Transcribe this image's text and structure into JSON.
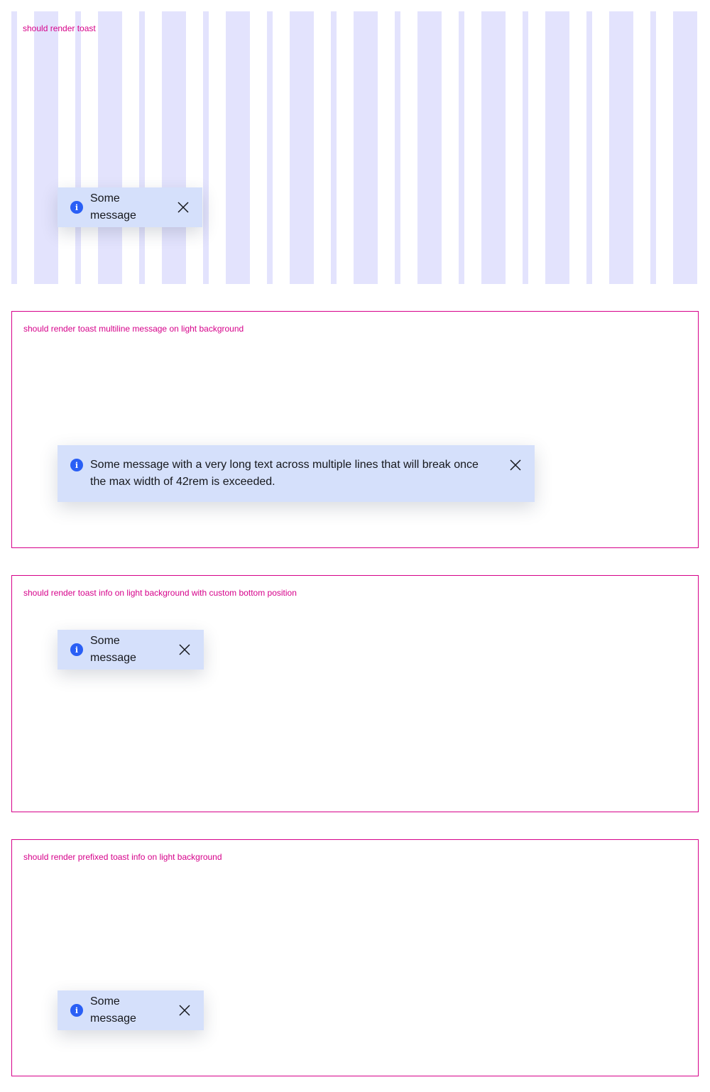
{
  "sections": [
    {
      "label": "should render toast",
      "toast": {
        "message": "Some message",
        "icon": "info-icon",
        "close_icon": "close-icon"
      }
    },
    {
      "label": "should render toast multiline message on light background",
      "toast": {
        "message": "Some message with a very long text across multiple lines that will break once the max width of 42rem is exceeded.",
        "icon": "info-icon",
        "close_icon": "close-icon"
      }
    },
    {
      "label": "should render toast info on light background with custom bottom position",
      "toast": {
        "message": "Some message",
        "icon": "info-icon",
        "close_icon": "close-icon"
      }
    },
    {
      "label": "should render prefixed toast info on light background",
      "toast": {
        "message": "Some message",
        "icon": "info-icon",
        "close_icon": "close-icon"
      }
    }
  ],
  "colors": {
    "label": "#d6008a",
    "toast_bg": "#d5e0fb",
    "info_icon": "#2a5ff5",
    "grid_stripe": "#e3e3fd"
  }
}
